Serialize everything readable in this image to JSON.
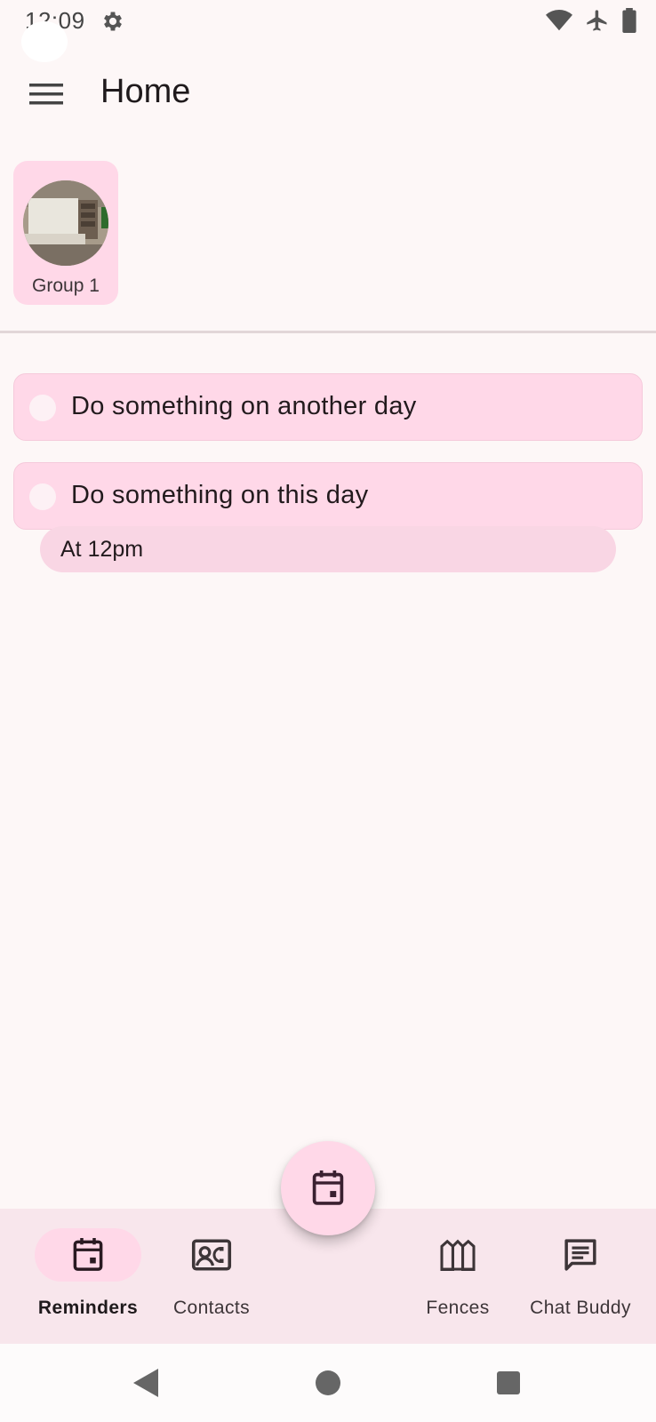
{
  "status_bar": {
    "time": "12:09",
    "icons": [
      "settings-gear-icon",
      "wifi-icon",
      "airplane-mode-icon",
      "battery-icon"
    ]
  },
  "top_bar": {
    "menu_icon": "hamburger-menu-icon",
    "title": "Home"
  },
  "groups": [
    {
      "label": "Group 1",
      "avatar": "group-photo"
    }
  ],
  "reminders": [
    {
      "text": "Do something on another day",
      "checked": false
    },
    {
      "text": "Do something on this day",
      "checked": false,
      "detail": "At 12pm"
    }
  ],
  "fab": {
    "icon": "calendar-event-icon"
  },
  "bottom_nav": {
    "items": [
      {
        "label": "Reminders",
        "icon": "calendar-event-icon",
        "active": true
      },
      {
        "label": "Contacts",
        "icon": "contact-card-icon",
        "active": false
      },
      {
        "label": "Fences",
        "icon": "fence-icon",
        "active": false
      },
      {
        "label": "Chat Buddy",
        "icon": "chat-message-icon",
        "active": false
      }
    ]
  },
  "system_nav": [
    "back-icon",
    "home-icon",
    "recents-icon"
  ],
  "colors": {
    "background": "#fdf7f7",
    "surface_pink": "#ffd8e8",
    "nav_bar": "#f8e6ec",
    "text": "#1f1a1c"
  }
}
